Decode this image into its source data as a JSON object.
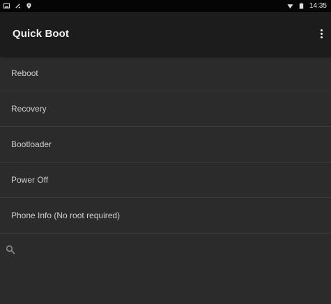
{
  "status_bar": {
    "time": "14:35",
    "left_icons": [
      "image-icon",
      "vibrate-icon",
      "location-icon"
    ],
    "right_icons": [
      "wifi-icon",
      "battery-icon"
    ]
  },
  "app_bar": {
    "title": "Quick Boot",
    "overflow_icon": "more-vert-icon"
  },
  "menu": {
    "items": [
      {
        "label": "Reboot"
      },
      {
        "label": "Recovery"
      },
      {
        "label": "Bootloader"
      },
      {
        "label": "Power Off"
      },
      {
        "label": "Phone Info (No root required)"
      }
    ]
  },
  "search": {
    "icon": "search-icon"
  },
  "colors": {
    "background": "#2b2b2b",
    "app_bar": "#1c1c1c",
    "status_bar": "#050505",
    "divider": "#3c3c3c",
    "text": "#cfcfcf"
  }
}
